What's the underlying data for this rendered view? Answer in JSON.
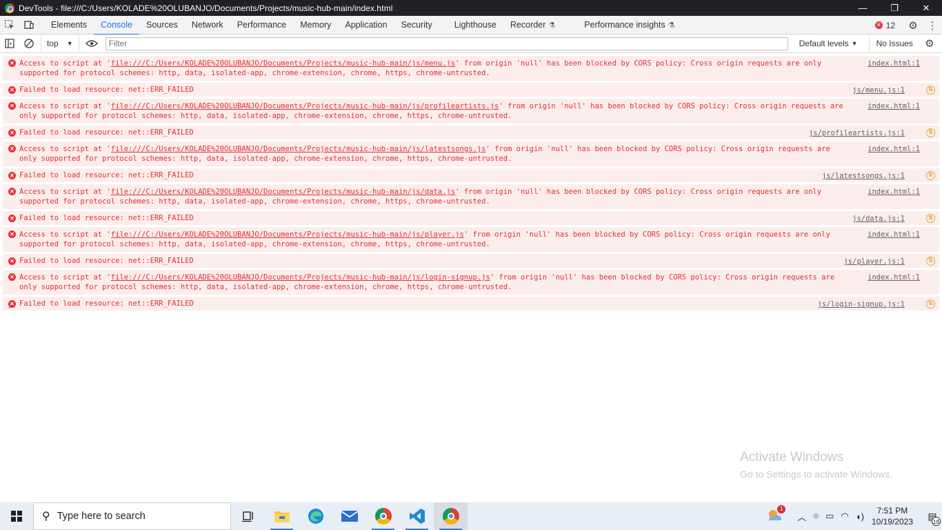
{
  "window": {
    "title": "DevTools - file:///C:/Users/KOLADE%20OLUBANJO/Documents/Projects/music-hub-main/index.html",
    "minimize": "—",
    "restore": "❐",
    "close": "✕"
  },
  "devtools": {
    "tabs": [
      {
        "label": "Elements"
      },
      {
        "label": "Console",
        "active": true
      },
      {
        "label": "Sources"
      },
      {
        "label": "Network"
      },
      {
        "label": "Performance"
      },
      {
        "label": "Memory"
      },
      {
        "label": "Application"
      },
      {
        "label": "Security"
      },
      {
        "label": "Lighthouse"
      },
      {
        "label": "Recorder"
      },
      {
        "label": "Performance insights"
      }
    ],
    "error_count": "12"
  },
  "console": {
    "context": "top",
    "filter_placeholder": "Filter",
    "levels": "Default levels",
    "issues": "No Issues",
    "messages": [
      {
        "pre": "Access to script at '",
        "url": "file:///C:/Users/KOLADE%20OLUBANJO/Documents/Projects/music-hub-main/js/menu.js",
        "post": "' from origin 'null' has been blocked by CORS policy: Cross origin requests are only supported for protocol schemes: http, data, isolated-app, chrome-extension, chrome, https, chrome-untrusted.",
        "source": "index.html:1"
      },
      {
        "pre": "Failed to load resource: net::ERR_FAILED",
        "url": "",
        "post": "",
        "source": "js/menu.js:1",
        "network": true
      },
      {
        "pre": "Access to script at '",
        "url": "file:///C:/Users/KOLADE%20OLUBANJO/Documents/Projects/music-hub-main/js/profileartists.js",
        "post": "' from origin 'null' has been blocked by CORS policy: Cross origin requests are only supported for protocol schemes: http, data, isolated-app, chrome-extension, chrome, https, chrome-untrusted.",
        "source": "index.html:1"
      },
      {
        "pre": "Failed to load resource: net::ERR_FAILED",
        "url": "",
        "post": "",
        "source": "js/profileartists.js:1",
        "network": true
      },
      {
        "pre": "Access to script at '",
        "url": "file:///C:/Users/KOLADE%20OLUBANJO/Documents/Projects/music-hub-main/js/latestsongs.js",
        "post": "' from origin 'null' has been blocked by CORS policy: Cross origin requests are only supported for protocol schemes: http, data, isolated-app, chrome-extension, chrome, https, chrome-untrusted.",
        "source": "index.html:1"
      },
      {
        "pre": "Failed to load resource: net::ERR_FAILED",
        "url": "",
        "post": "",
        "source": "js/latestsongs.js:1",
        "network": true
      },
      {
        "pre": "Access to script at '",
        "url": "file:///C:/Users/KOLADE%20OLUBANJO/Documents/Projects/music-hub-main/js/data.js",
        "post": "' from origin 'null' has been blocked by CORS policy: Cross origin requests are only supported for protocol schemes: http, data, isolated-app, chrome-extension, chrome, https, chrome-untrusted.",
        "source": "index.html:1"
      },
      {
        "pre": "Failed to load resource: net::ERR_FAILED",
        "url": "",
        "post": "",
        "source": "js/data.js:1",
        "network": true
      },
      {
        "pre": "Access to script at '",
        "url": "file:///C:/Users/KOLADE%20OLUBANJO/Documents/Projects/music-hub-main/js/player.js",
        "post": "' from origin 'null' has been blocked by CORS policy: Cross origin requests are only supported for protocol schemes: http, data, isolated-app, chrome-extension, chrome, https, chrome-untrusted.",
        "source": "index.html:1"
      },
      {
        "pre": "Failed to load resource: net::ERR_FAILED",
        "url": "",
        "post": "",
        "source": "js/player.js:1",
        "network": true
      },
      {
        "pre": "Access to script at '",
        "url": "file:///C:/Users/KOLADE%20OLUBANJO/Documents/Projects/music-hub-main/js/login-signup.js",
        "post": "' from origin 'null' has been blocked by CORS policy: Cross origin requests are only supported for protocol schemes: http, data, isolated-app, chrome-extension, chrome, https, chrome-untrusted.",
        "source": "index.html:1"
      },
      {
        "pre": "Failed to load resource: net::ERR_FAILED",
        "url": "",
        "post": "",
        "source": "js/login-signup.js:1",
        "network": true
      }
    ]
  },
  "watermark": {
    "line1": "Activate Windows",
    "line2": "Go to Settings to activate Windows."
  },
  "taskbar": {
    "search_placeholder": "Type here to search",
    "time": "7:51 PM",
    "date": "10/19/2023",
    "notification_count": "18",
    "weather_badge": "1",
    "colors": {
      "accent": "#1a73e8",
      "error": "#e12f2f"
    }
  }
}
